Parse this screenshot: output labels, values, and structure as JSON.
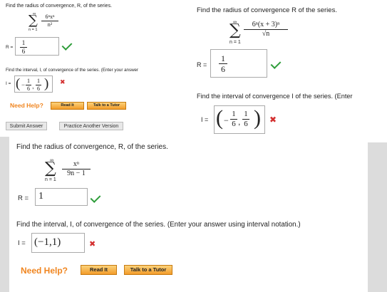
{
  "panel1": {
    "question": "Find the radius of convergence, R, of the series.",
    "sum_top": "∞",
    "sum_bottom": "n = 1",
    "term_num": "6ⁿxⁿ",
    "term_den": "n²",
    "r_label": "R =",
    "r_num": "1",
    "r_den": "6",
    "interval_question": "Find the interval, I, of convergence of the series. (Enter your answer",
    "i_label": "I =",
    "i_open": "(",
    "i_minus": "−",
    "i_a_num": "1",
    "i_a_den": "6",
    "i_comma": ",",
    "i_b_num": "1",
    "i_b_den": "6",
    "i_close": ")",
    "need_help": "Need Help?",
    "read_it": "Read It",
    "talk_tutor": "Talk to a Tutor",
    "submit": "Submit Answer",
    "practice": "Practice Another Version",
    "check_icon": "check-icon",
    "cross_icon": "x-icon",
    "cross_glyph": "✖"
  },
  "panel2": {
    "question": "Find the radius of convergence R of the series.",
    "sum_top": "∞",
    "sum_bottom": "n = 1",
    "term_num": "6ⁿ(x + 3)ⁿ",
    "term_den": "√n",
    "r_label": "R =",
    "r_num": "1",
    "r_den": "6",
    "interval_question": "Find the interval of convergence I of the series. (Enter",
    "i_label": "I =",
    "i_open": "(",
    "i_minus": "−",
    "i_a_num": "1",
    "i_a_den": "6",
    "i_comma": ",",
    "i_b_num": "1",
    "i_b_den": "6",
    "i_close": ")",
    "cross_glyph": "✖"
  },
  "panel3": {
    "question": "Find the radius of convergence, R, of the series.",
    "sum_top": "∞",
    "sum_bottom": "n = 1",
    "term_num": "xⁿ",
    "term_den": "9n − 1",
    "r_label": "R =",
    "r_value": "1",
    "interval_question": "Find the interval, I, of convergence of the series. (Enter your answer using interval notation.)",
    "i_label": "I =",
    "i_value": "(−1,1)",
    "need_help": "Need Help?",
    "read_it": "Read It",
    "talk_tutor": "Talk to a Tutor",
    "cross_glyph": "✖"
  },
  "colors": {
    "check": "#2e9d3a",
    "cross": "#d32f2f",
    "need_help": "#f0851f",
    "button": "#f39c2a"
  }
}
